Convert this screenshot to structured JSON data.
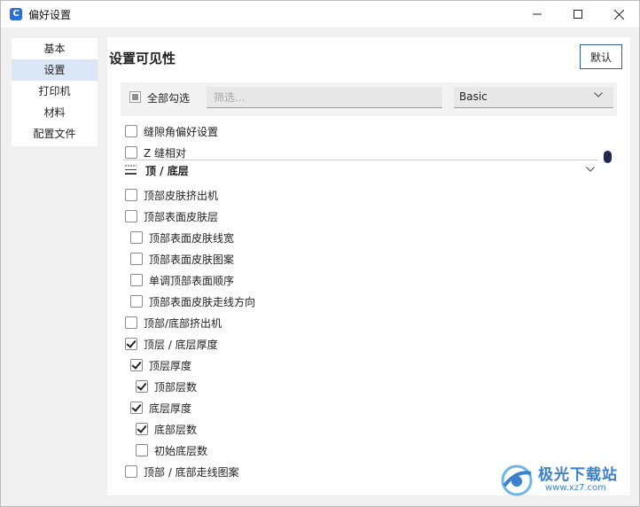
{
  "window": {
    "title": "偏好设置"
  },
  "sidebar": {
    "items": [
      {
        "label": "基本",
        "active": false
      },
      {
        "label": "设置",
        "active": true
      },
      {
        "label": "打印机",
        "active": false
      },
      {
        "label": "材料",
        "active": false
      },
      {
        "label": "配置文件",
        "active": false
      }
    ]
  },
  "panel": {
    "title": "设置可见性",
    "default_button": "默认",
    "select_all_label": "全部勾选",
    "filter_placeholder": "筛选...",
    "mode_value": "Basic"
  },
  "settings": {
    "top_rows": [
      {
        "label": "缝隙角偏好设置",
        "checked": false
      },
      {
        "label": "Z 缝相对",
        "checked": false
      }
    ],
    "section_title": "顶 / 底层",
    "rows": [
      {
        "label": "顶部皮肤挤出机",
        "checked": false
      },
      {
        "label": "顶部表面皮肤层",
        "checked": false
      },
      {
        "label": "顶部表面皮肤线宽",
        "checked": false
      },
      {
        "label": "顶部表面皮肤图案",
        "checked": false
      },
      {
        "label": "单调顶部表面顺序",
        "checked": false
      },
      {
        "label": "顶部表面皮肤走线方向",
        "checked": false
      },
      {
        "label": "顶部/底部挤出机",
        "checked": false
      },
      {
        "label": "顶层 / 底层厚度",
        "checked": true
      },
      {
        "label": "顶层厚度",
        "checked": true
      },
      {
        "label": "顶部层数",
        "checked": true
      },
      {
        "label": "底层厚度",
        "checked": true
      },
      {
        "label": "底部层数",
        "checked": true
      },
      {
        "label": "初始底层数",
        "checked": false
      },
      {
        "label": "顶部 / 底部走线图案",
        "checked": false
      }
    ]
  },
  "watermark": {
    "name": "极光下载站",
    "url": "www.xz7.com"
  },
  "colors": {
    "accent": "#2f5bb7",
    "sidebar_active": "#dbe6f6",
    "scroll_thumb": "#1e2a55"
  }
}
